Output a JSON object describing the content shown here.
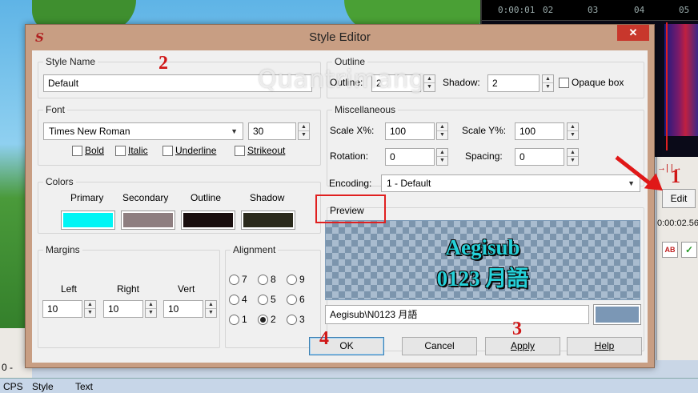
{
  "background": {
    "audio_ticks": [
      "0:00:01",
      "02",
      "03",
      "04",
      "05"
    ],
    "edit_button": "Edit",
    "time_readout": "0:00:02.56",
    "ab_label": "AB",
    "left_value": "0 -",
    "statusbar": [
      "CPS",
      "Style",
      "Text"
    ]
  },
  "dialog": {
    "title": "Style Editor",
    "close_label": "✕",
    "style_name": {
      "legend": "Style Name",
      "value": "Default"
    },
    "font": {
      "legend": "Font",
      "family": "Times New Roman",
      "size": "30",
      "bold": "Bold",
      "italic": "Italic",
      "underline": "Underline",
      "strikeout": "Strikeout"
    },
    "colors": {
      "legend": "Colors",
      "items": [
        {
          "label": "Primary",
          "hex": "#00f5f5"
        },
        {
          "label": "Secondary",
          "hex": "#8e7e80"
        },
        {
          "label": "Outline",
          "hex": "#1a0f0f"
        },
        {
          "label": "Shadow",
          "hex": "#2b2a1c"
        }
      ]
    },
    "margins": {
      "legend": "Margins",
      "left_label": "Left",
      "right_label": "Right",
      "vert_label": "Vert",
      "left": "10",
      "right": "10",
      "vert": "10"
    },
    "alignment": {
      "legend": "Alignment",
      "options": [
        "7",
        "8",
        "9",
        "4",
        "5",
        "6",
        "1",
        "2",
        "3"
      ],
      "selected": "2"
    },
    "outline": {
      "legend": "Outline",
      "outline_label": "Outline:",
      "outline_value": "2",
      "shadow_label": "Shadow:",
      "shadow_value": "2",
      "opaque_label": "Opaque box"
    },
    "misc": {
      "legend": "Miscellaneous",
      "scalex_label": "Scale X%:",
      "scalex": "100",
      "scaley_label": "Scale Y%:",
      "scaley": "100",
      "rotation_label": "Rotation:",
      "rotation": "0",
      "spacing_label": "Spacing:",
      "spacing": "0",
      "encoding_label": "Encoding:",
      "encoding": "1 - Default"
    },
    "preview": {
      "legend": "Preview",
      "line1": "Aegisub",
      "line2": "0123 月語",
      "text_input": "Aegisub\\N0123 月語",
      "bg_color": "#7b97b5"
    },
    "buttons": {
      "ok": "OK",
      "cancel": "Cancel",
      "apply": "Apply",
      "help": "Help"
    }
  },
  "annotations": {
    "n1": "1",
    "n2": "2",
    "n3": "3",
    "n4": "4"
  },
  "watermark": "Quantrimang"
}
